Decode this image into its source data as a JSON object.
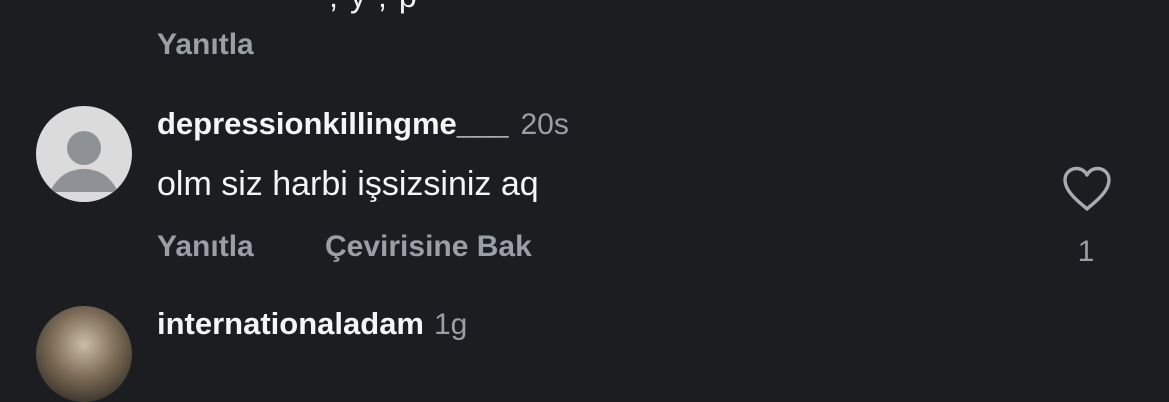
{
  "prev_comment": {
    "reply_label": "Yanıtla"
  },
  "comment": {
    "username": "depressionkillingme___",
    "time": "20s",
    "text": "olm siz harbi işsizsiniz aq",
    "reply_label": "Yanıtla",
    "translate_label": "Çevirisine Bak",
    "like_count": "1",
    "like_icon": "heart-outline-icon"
  },
  "next_comment": {
    "username": "internationaladam",
    "time": "1g"
  },
  "colors": {
    "background": "#1b1d20",
    "primary_text": "#f5f5f5",
    "secondary_text": "#9a9ea5",
    "avatar_placeholder": "#dbdbdb",
    "avatar_silhouette": "#8e9196"
  }
}
